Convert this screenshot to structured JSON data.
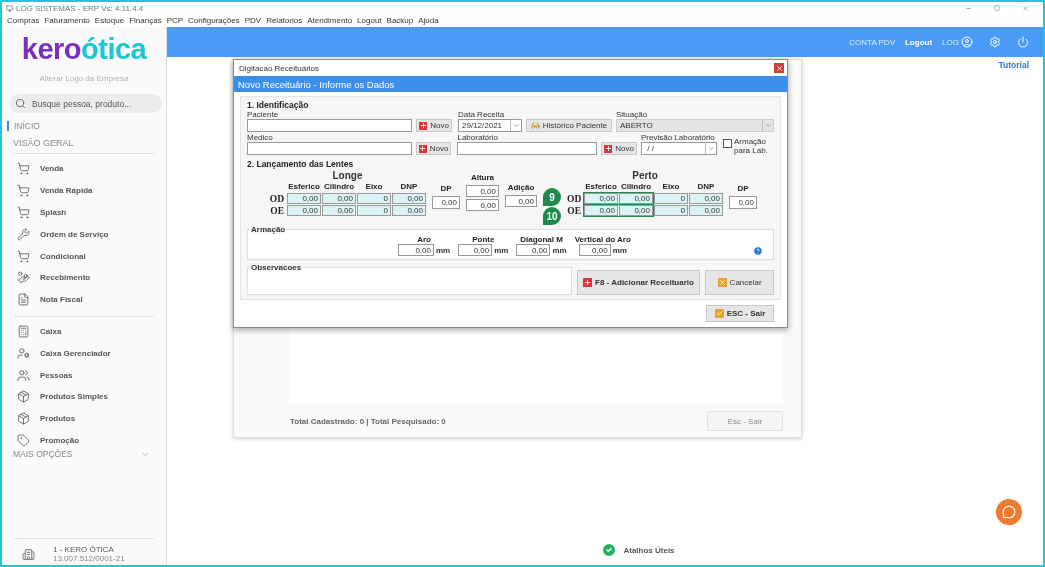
{
  "app_window": {
    "title": "LOG SISTEMAS - ERP Vs: 4.11.4.4"
  },
  "menu": [
    "Compras",
    "Faturamento",
    "Estoque",
    "Finanças",
    "PCP",
    "Configurações",
    "PDV",
    "Relatorios",
    "Atendimento",
    "Logout",
    "Backup",
    "Ajuda"
  ],
  "sidebar": {
    "logo": {
      "part_1": "kero",
      "part_2": "ótica"
    },
    "change_logo": "Alterar Logo da Empresa",
    "search": {
      "placeholder": "Busque pessoa, produto..."
    },
    "home": {
      "label": "INÍCIO",
      "selected": true
    },
    "section": "VISÃO GERAL",
    "groups": [
      {
        "items": [
          {
            "label": "Venda"
          },
          {
            "label": "Venda Rápida"
          },
          {
            "label": "Splash"
          },
          {
            "label": "Ordem de Serviço"
          },
          {
            "label": "Condicional"
          },
          {
            "label": "Recebimento"
          },
          {
            "label": "Nota Fiscal"
          }
        ]
      },
      {
        "items": [
          {
            "label": "Caixa"
          },
          {
            "label": "Caixa Gerenciador"
          },
          {
            "label": "Pessoas"
          },
          {
            "label": "Produtos Simples"
          },
          {
            "label": "Produtos"
          },
          {
            "label": "Promoção"
          }
        ]
      }
    ],
    "more": "MAIS OPÇÕES",
    "company": {
      "name": "1 - KERO ÓTICA",
      "cnpj": "13.007.512/0001-21"
    }
  },
  "header": {
    "account": "CONTA PDV",
    "logout": "Logout",
    "user": "LOG",
    "tutorial": "Tutorial"
  },
  "background_window": {
    "totals": "Total Cadastrado: 0 | Total Pesquisado: 0",
    "exit_button": "Esc - Sair"
  },
  "dialog": {
    "title": "Digitacao Receituários",
    "subtitle": "Novo Receituário - Informe os Dados",
    "identification": {
      "heading": "1. Identificação",
      "patient": {
        "label": "Paciente",
        "button": "Novo"
      },
      "date": {
        "label": "Data Receita",
        "value": "29/12/2021"
      },
      "history_button": "Histórico Paciente",
      "status": {
        "label": "Situação",
        "value": "ABERTO"
      },
      "doctor": {
        "label": "Medico",
        "button": "Novo"
      },
      "lab": {
        "label": "Laboratório",
        "button": "Novo"
      },
      "lab_forecast": {
        "label": "Previsão Laboratório",
        "value": " / /"
      },
      "frame_for_lab": {
        "label": "Armação para Lab.",
        "checked": false
      }
    },
    "lenses": {
      "heading": "2. Lançamento das Lentes",
      "far": {
        "title": "Longe",
        "columns": [
          "Esferico",
          "Cilindro",
          "Eixo",
          "DNP"
        ],
        "rows": [
          {
            "eye": "OD",
            "values": [
              "0,00",
              "0,00",
              "0",
              "0,00"
            ],
            "highlighted": false
          },
          {
            "eye": "OE",
            "values": [
              "0,00",
              "0,00",
              "0",
              "0,00"
            ],
            "highlighted": false
          }
        ],
        "dp": {
          "label": "DP",
          "value": "0,00"
        }
      },
      "height": {
        "label": "Altura",
        "values": [
          "0,00",
          "0,00"
        ]
      },
      "addition": {
        "label": "Adição",
        "value": "0,00"
      },
      "near": {
        "title": "Perto",
        "columns": [
          "Esferico",
          "Cilindro",
          "Eixo",
          "DNP"
        ],
        "rows": [
          {
            "eye": "OD",
            "values": [
              "0,00",
              "0,00",
              "0",
              "0,00"
            ],
            "highlighted": true
          },
          {
            "eye": "OE",
            "values": [
              "0,00",
              "0,00",
              "0",
              "0,00"
            ],
            "highlighted": true
          }
        ],
        "dp": {
          "label": "DP",
          "value": "0,00"
        }
      }
    },
    "frame": {
      "legend": "Armação",
      "fields": [
        {
          "label": "Aro",
          "value": "0,00",
          "unit": "mm"
        },
        {
          "label": "Ponte",
          "value": "0,00",
          "unit": "mm"
        },
        {
          "label": "Diagonal M",
          "value": "0,00",
          "unit": "mm"
        },
        {
          "label": "Vertical do Aro",
          "value": "0,00",
          "unit": "mm"
        }
      ]
    },
    "notes": {
      "legend": "Observacoes"
    },
    "add_button": "F8 - Adicionar Receituario",
    "cancel_button": "Cancelar",
    "exit_button": "ESC - Sair",
    "callouts": [
      {
        "number": "9"
      },
      {
        "number": "10"
      }
    ]
  },
  "shortcuts": "Atalhos Úteis"
}
